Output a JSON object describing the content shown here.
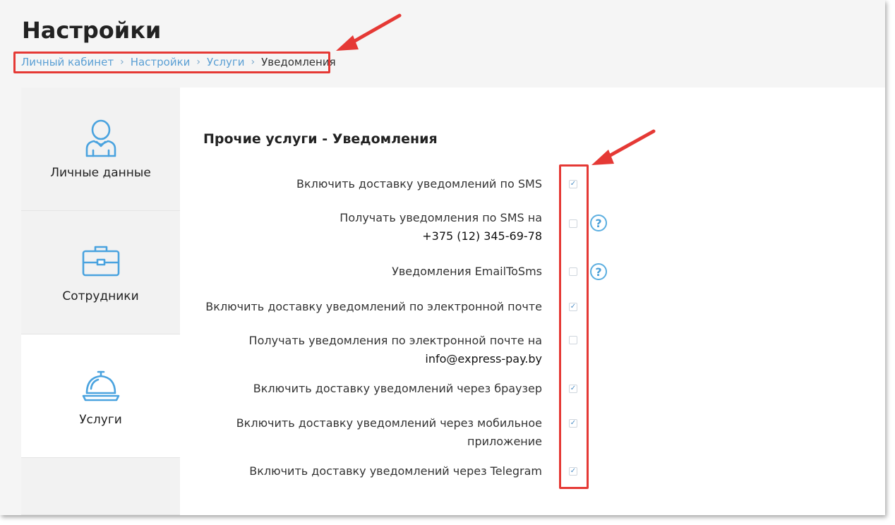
{
  "header": {
    "title": "Настройки",
    "breadcrumb": [
      {
        "label": "Личный кабинет"
      },
      {
        "label": "Настройки"
      },
      {
        "label": "Услуги"
      }
    ],
    "breadcrumb_current": "Уведомления"
  },
  "sidebar": {
    "items": [
      {
        "label": "Личные данные",
        "icon": "user-icon"
      },
      {
        "label": "Сотрудники",
        "icon": "briefcase-icon"
      },
      {
        "label": "Услуги",
        "icon": "service-bell-icon"
      }
    ]
  },
  "main": {
    "section_title": "Прочие услуги - Уведомления",
    "settings": [
      {
        "label": "Включить доставку уведомлений по SMS",
        "extra": "",
        "checked": true,
        "help": false
      },
      {
        "label": "Получать уведомления по SMS на",
        "extra": "+375 (12) 345-69-78",
        "checked": false,
        "help": true
      },
      {
        "label": "Уведомления EmailToSms",
        "extra": "",
        "checked": false,
        "help": true
      },
      {
        "label": "Включить доставку уведомлений по электронной почте",
        "extra": "",
        "checked": true,
        "help": false
      },
      {
        "label": "Получать уведомления по электронной почте на",
        "extra": "info@express-pay.by",
        "checked": false,
        "help": false
      },
      {
        "label": "Включить доставку уведомлений через браузер",
        "extra": "",
        "checked": true,
        "help": false
      },
      {
        "label": "Включить доставку уведомлений через мобильное",
        "extra": "приложение",
        "checked": true,
        "help": false
      },
      {
        "label": "Включить доставку уведомлений через Telegram",
        "extra": "",
        "checked": true,
        "help": false
      }
    ],
    "help_symbol": "?",
    "check_symbol": "✓"
  },
  "colors": {
    "accent": "#5a9fd4",
    "highlight": "#e53935",
    "icon": "#4aa3df"
  }
}
